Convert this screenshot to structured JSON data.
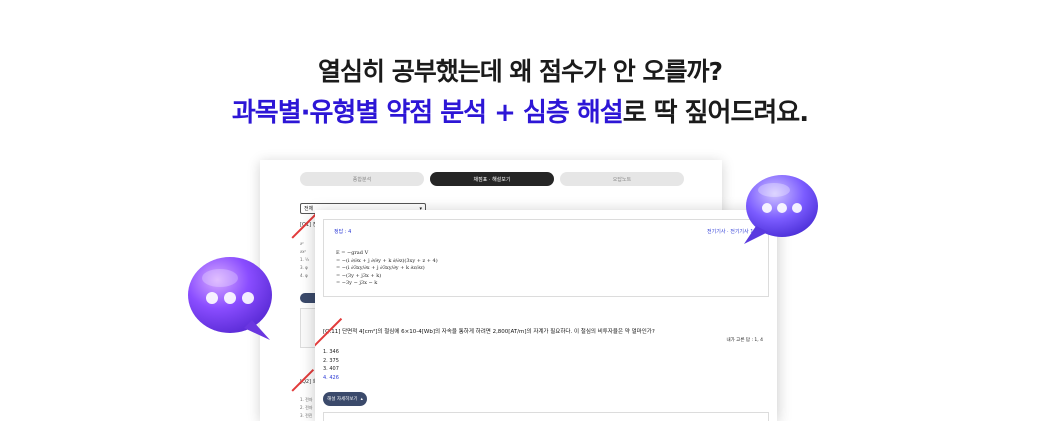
{
  "headline": {
    "line1": "열심히 공부했는데 왜 점수가 안 오를까?",
    "line2_accent": "과목별·유형별 약점 분석 + 심층 해설",
    "line2_rest": "로 딱 짚어드려요."
  },
  "back_window": {
    "tabs": [
      "종합분석",
      "채점표 · 해설보기",
      "오답노트"
    ],
    "active_tab": 1,
    "select_value": "전체",
    "q1_label": "[Q1] 전",
    "q2_label": "[Q2] 회",
    "list": [
      "1. 전자",
      "2. 전자",
      "3. 전진"
    ]
  },
  "front_window": {
    "answer_label": "정답 : 4",
    "source_label": "전기기사 · 전기기사 1회",
    "question": "[Q.11] 단면적 4[cm²]의 철심에 6×10-4[Wb]의 자속을 통하게 하려면 2,800[AT/m]의 자계가 필요하다. 이 철심의 비투자율은 약 얼마인가?",
    "difficulty": "내가 고른 답 : 1, 4",
    "choices": [
      "1.  346",
      "2.  375",
      "3.  407",
      "4.  426"
    ],
    "correct_index": 3,
    "explain_button": "해설 자세히보기"
  },
  "colors": {
    "accent": "#2d16d6",
    "correct": "#2d3bd6",
    "button": "#3b4a6b"
  },
  "icons": [
    "chat-bubble-icon",
    "chevron-down-icon",
    "chevron-up-icon"
  ]
}
